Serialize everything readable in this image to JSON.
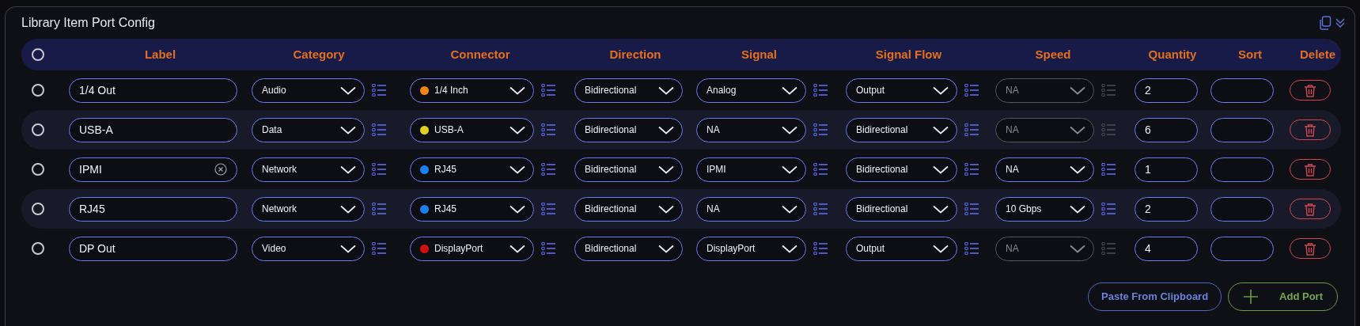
{
  "title": "Library Item Port Config",
  "header": {
    "select_all_selected": false,
    "columns": [
      "Label",
      "Category",
      "Connector",
      "Direction",
      "Signal",
      "Signal Flow",
      "Speed",
      "Quantity",
      "Sort",
      "Delete"
    ]
  },
  "rows": [
    {
      "selected": false,
      "label": "1/4 Out",
      "show_clear": false,
      "category": "Audio",
      "connector": {
        "text": "1/4 Inch",
        "color": "#f08418"
      },
      "direction": "Bidirectional",
      "signal": "Analog",
      "signal_flow": "Output",
      "speed": {
        "text": "NA",
        "disabled": true
      },
      "quantity": "2"
    },
    {
      "selected": false,
      "label": "USB-A",
      "show_clear": false,
      "category": "Data",
      "connector": {
        "text": "USB-A",
        "color": "#e0d020"
      },
      "direction": "Bidirectional",
      "signal": "NA",
      "signal_flow": "Bidirectional",
      "speed": {
        "text": "NA",
        "disabled": true
      },
      "quantity": "6"
    },
    {
      "selected": false,
      "label": "IPMI",
      "show_clear": true,
      "category": "Network",
      "connector": {
        "text": "RJ45",
        "color": "#1a7ff0"
      },
      "direction": "Bidirectional",
      "signal": "IPMI",
      "signal_flow": "Bidirectional",
      "speed": {
        "text": "NA",
        "disabled": false
      },
      "quantity": "1"
    },
    {
      "selected": false,
      "label": "RJ45",
      "show_clear": false,
      "category": "Network",
      "connector": {
        "text": "RJ45",
        "color": "#1a7ff0"
      },
      "direction": "Bidirectional",
      "signal": "NA",
      "signal_flow": "Bidirectional",
      "speed": {
        "text": "10 Gbps",
        "disabled": false
      },
      "quantity": "2"
    },
    {
      "selected": false,
      "label": "DP Out",
      "show_clear": false,
      "category": "Video",
      "connector": {
        "text": "DisplayPort",
        "color": "#d01010"
      },
      "direction": "Bidirectional",
      "signal": "DisplayPort",
      "signal_flow": "Output",
      "speed": {
        "text": "NA",
        "disabled": true
      },
      "quantity": "4"
    }
  ],
  "buttons": {
    "paste": "Paste From Clipboard",
    "add": "Add Port"
  }
}
